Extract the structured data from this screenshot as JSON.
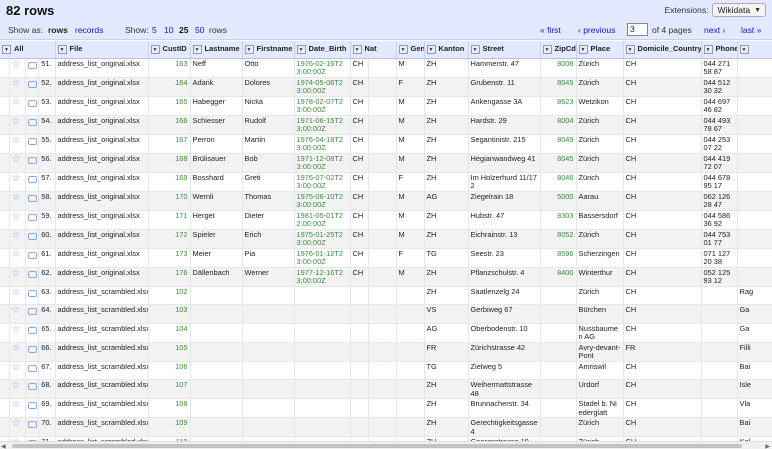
{
  "header": {
    "rows_title": "82 rows",
    "extensions_label": "Extensions:",
    "extensions_value": "Wikidata"
  },
  "view": {
    "show_as_label": "Show as:",
    "rows_link": "rows",
    "records_link": "records",
    "show_label": "Show:",
    "page_sizes": [
      "5",
      "10",
      "25",
      "50"
    ],
    "active_page_size": "25",
    "rows_suffix": "rows",
    "first": "« first",
    "previous": "‹ previous",
    "current_page": "3",
    "of_pages": "of 4 pages",
    "next": "next ›",
    "last": "last »"
  },
  "columns": [
    "All",
    "File",
    "CustID",
    "Lastname",
    "Firstname",
    "Date_Birth",
    "Nat",
    "Gender",
    "Kanton",
    "Street",
    "ZipCd",
    "Place",
    "Domicile_Country",
    "Phone",
    ""
  ],
  "rows": [
    {
      "n": "51.",
      "file": "address_list_original.xlsx",
      "id": "163",
      "last": "Neff",
      "first": "Otto",
      "dob": "1976-02-16T23:00:00Z",
      "nat": "CH",
      "g": "M",
      "k": "ZH",
      "street": "Hammerstr. 47",
      "zip": "8008",
      "place": "Zürich",
      "dc": "CH",
      "phone": "044 271 58 87",
      "extra": ""
    },
    {
      "n": "52.",
      "file": "address_list_original.xlsx",
      "id": "164",
      "last": "Adank",
      "first": "Dolores",
      "dob": "1974-05-06T23:00:00Z",
      "nat": "CH",
      "g": "F",
      "k": "ZH",
      "street": "Grubenstr. 11",
      "zip": "8045",
      "place": "Zürich",
      "dc": "CH",
      "phone": "044 512 30 32",
      "extra": ""
    },
    {
      "n": "53.",
      "file": "address_list_original.xlsx",
      "id": "165",
      "last": "Habegger",
      "first": "Nicka",
      "dob": "1978-02-07T23:00:00Z",
      "nat": "CH",
      "g": "M",
      "k": "ZH",
      "street": "Ankengasse 3A",
      "zip": "8623",
      "place": "Wetzikon",
      "dc": "CH",
      "phone": "044 697 46 82",
      "extra": ""
    },
    {
      "n": "54.",
      "file": "address_list_original.xlsx",
      "id": "166",
      "last": "Schiesser",
      "first": "Rudolf",
      "dob": "1971-06-15T23:00:00Z",
      "nat": "CH",
      "g": "M",
      "k": "ZH",
      "street": "Hardstr. 29",
      "zip": "8004",
      "place": "Zürich",
      "dc": "CH",
      "phone": "044 493 78 67",
      "extra": ""
    },
    {
      "n": "55.",
      "file": "address_list_original.xlsx",
      "id": "167",
      "last": "Perron",
      "first": "Martin",
      "dob": "1976-04-18T23:00:00Z",
      "nat": "CH",
      "g": "M",
      "k": "ZH",
      "street": "Segantinistr. 215",
      "zip": "8049",
      "place": "Zürich",
      "dc": "CH",
      "phone": "044 253 07 22",
      "extra": ""
    },
    {
      "n": "56.",
      "file": "address_list_original.xlsx",
      "id": "168",
      "last": "Brülisauer",
      "first": "Bob",
      "dob": "1971-12-08T23:00:00Z",
      "nat": "CH",
      "g": "M",
      "k": "ZH",
      "street": "Hegianwandweg 41",
      "zip": "8045",
      "place": "Zürich",
      "dc": "CH",
      "phone": "044 419 72 07",
      "extra": ""
    },
    {
      "n": "57.",
      "file": "address_list_original.xlsx",
      "id": "169",
      "last": "Bosshard",
      "first": "Greti",
      "dob": "1976-07-02T23:00:00Z",
      "nat": "CH",
      "g": "F",
      "k": "ZH",
      "street": "Im Holzerhurd 11/172",
      "zip": "8046",
      "place": "Zürich",
      "dc": "CH",
      "phone": "044 678 95 17",
      "extra": ""
    },
    {
      "n": "58.",
      "file": "address_list_original.xlsx",
      "id": "170",
      "last": "Wernli",
      "first": "Thomas",
      "dob": "1975-06-10T23:00:00Z",
      "nat": "CH",
      "g": "M",
      "k": "AG",
      "street": "Ziegelrain 18",
      "zip": "5000",
      "place": "Aarau",
      "dc": "CH",
      "phone": "062 126 28 47",
      "extra": ""
    },
    {
      "n": "59.",
      "file": "address_list_original.xlsx",
      "id": "171",
      "last": "Herget",
      "first": "Dieter",
      "dob": "1981-05-01T22:00:00Z",
      "nat": "CH",
      "g": "M",
      "k": "ZH",
      "street": "Hubstr. 47",
      "zip": "8303",
      "place": "Bassersdorf",
      "dc": "CH",
      "phone": "044 586 36 92",
      "extra": ""
    },
    {
      "n": "60.",
      "file": "address_list_original.xlsx",
      "id": "172",
      "last": "Spieler",
      "first": "Erich",
      "dob": "1975-01-25T23:00:00Z",
      "nat": "CH",
      "g": "M",
      "k": "ZH",
      "street": "Eichrainstr. 13",
      "zip": "8052",
      "place": "Zürich",
      "dc": "CH",
      "phone": "044 753 01 77",
      "extra": ""
    },
    {
      "n": "61.",
      "file": "address_list_original.xlsx",
      "id": "173",
      "last": "Meier",
      "first": "Pia",
      "dob": "1976-01-12T23:00:00Z",
      "nat": "CH",
      "g": "F",
      "k": "TG",
      "street": "Seestr. 23",
      "zip": "8596",
      "place": "Scherzingen",
      "dc": "CH",
      "phone": "071 127 20 38",
      "extra": ""
    },
    {
      "n": "62.",
      "file": "address_list_original.xlsx",
      "id": "176",
      "last": "Dällenbach",
      "first": "Werner",
      "dob": "1977-12-16T23:00:00Z",
      "nat": "CH",
      "g": "M",
      "k": "ZH",
      "street": "Pflanzschulstr. 4",
      "zip": "8400",
      "place": "Winterthur",
      "dc": "CH",
      "phone": "052 125 93 12",
      "extra": ""
    },
    {
      "n": "63.",
      "file": "address_list_scrambled.xlsx",
      "id": "102",
      "last": "",
      "first": "",
      "dob": "",
      "nat": "",
      "g": "",
      "k": "ZH",
      "street": "Saatlenzelg 24",
      "zip": "",
      "place": "Zürich",
      "dc": "CH",
      "phone": "",
      "extra": "Rag"
    },
    {
      "n": "64.",
      "file": "address_list_scrambled.xlsx",
      "id": "103",
      "last": "",
      "first": "",
      "dob": "",
      "nat": "",
      "g": "",
      "k": "VS",
      "street": "Gerbiweg 67",
      "zip": "",
      "place": "Bürchen",
      "dc": "CH",
      "phone": "",
      "extra": "Ga"
    },
    {
      "n": "65.",
      "file": "address_list_scrambled.xlsx",
      "id": "104",
      "last": "",
      "first": "",
      "dob": "",
      "nat": "",
      "g": "",
      "k": "AG",
      "street": "Oberbodenstr. 10",
      "zip": "",
      "place": "Nussbaumen AG",
      "dc": "CH",
      "phone": "",
      "extra": "Ga"
    },
    {
      "n": "66.",
      "file": "address_list_scrambled.xlsx",
      "id": "105",
      "last": "",
      "first": "",
      "dob": "",
      "nat": "",
      "g": "",
      "k": "FR",
      "street": "Zürichstrasse 42",
      "zip": "",
      "place": "Avry-devant-Pont",
      "dc": "FR",
      "phone": "",
      "extra": "Filli"
    },
    {
      "n": "67.",
      "file": "address_list_scrambled.xlsx",
      "id": "106",
      "last": "",
      "first": "",
      "dob": "",
      "nat": "",
      "g": "",
      "k": "TG",
      "street": "Zielweg 5",
      "zip": "",
      "place": "Amriswil",
      "dc": "CH",
      "phone": "",
      "extra": "Bai"
    },
    {
      "n": "68.",
      "file": "address_list_scrambled.xlsx",
      "id": "107",
      "last": "",
      "first": "",
      "dob": "",
      "nat": "",
      "g": "",
      "k": "ZH",
      "street": "Weihermattstrasse 48",
      "zip": "",
      "place": "Urdorf",
      "dc": "CH",
      "phone": "",
      "extra": "Isle"
    },
    {
      "n": "69.",
      "file": "address_list_scrambled.xlsx",
      "id": "108",
      "last": "",
      "first": "",
      "dob": "",
      "nat": "",
      "g": "",
      "k": "ZH",
      "street": "Brunnacherstr. 34",
      "zip": "",
      "place": "Stadel b. Niederglatt",
      "dc": "CH",
      "phone": "",
      "extra": "Vla"
    },
    {
      "n": "70.",
      "file": "address_list_scrambled.xlsx",
      "id": "109",
      "last": "",
      "first": "",
      "dob": "",
      "nat": "",
      "g": "",
      "k": "ZH",
      "street": "Gerechtigkeitsgasse 4",
      "zip": "",
      "place": "Zürich",
      "dc": "CH",
      "phone": "",
      "extra": "Bai"
    },
    {
      "n": "71.",
      "file": "address_list_scrambled.xlsx",
      "id": "110",
      "last": "",
      "first": "",
      "dob": "",
      "nat": "",
      "g": "",
      "k": "ZH",
      "street": "Georgsstrasse 19",
      "zip": "",
      "place": "Zürich",
      "dc": "CH",
      "phone": "",
      "extra": "Kel"
    }
  ],
  "icons": {
    "star": "star-icon",
    "flag": "flag-icon",
    "column_menu": "chevron-down-icon"
  }
}
